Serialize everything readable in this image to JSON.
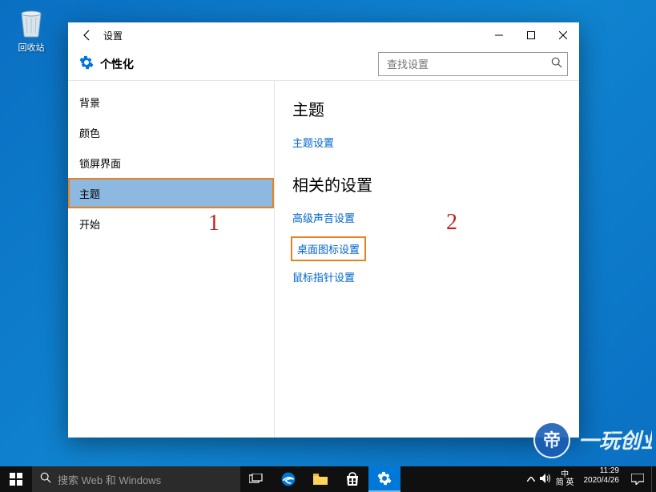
{
  "desktop": {
    "recycle_bin_label": "回收站"
  },
  "window": {
    "title": "设置",
    "header_title": "个性化",
    "search_placeholder": "查找设置"
  },
  "sidebar": {
    "items": [
      {
        "label": "背景"
      },
      {
        "label": "颜色"
      },
      {
        "label": "锁屏界面"
      },
      {
        "label": "主题"
      },
      {
        "label": "开始"
      }
    ]
  },
  "content": {
    "section1_title": "主题",
    "link_theme_settings": "主题设置",
    "section2_title": "相关的设置",
    "link_sound": "高级声音设置",
    "link_desktop_icon": "桌面图标设置",
    "link_mouse": "鼠标指针设置"
  },
  "annotations": {
    "mark1": "1",
    "mark2": "2"
  },
  "taskbar": {
    "search_placeholder": "搜索 Web 和 Windows",
    "ime_line1": "中",
    "ime_line2": "简 英",
    "clock_time": "11:29",
    "clock_date": "2020/4/26"
  }
}
